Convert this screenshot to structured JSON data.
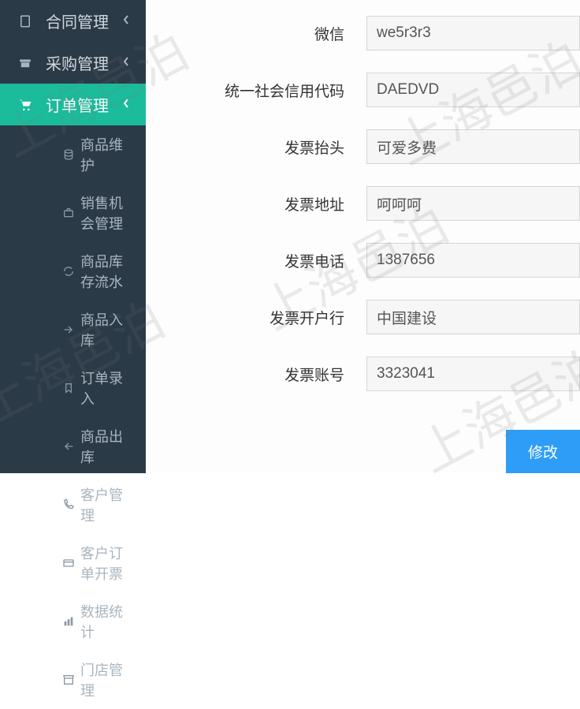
{
  "watermark": "上海邑泊",
  "sidebar": {
    "top_items": [
      {
        "label": "合同管理"
      },
      {
        "label": "采购管理"
      },
      {
        "label": "订单管理"
      }
    ],
    "sub_items": [
      {
        "label": "商品维护"
      },
      {
        "label": "销售机会管理"
      },
      {
        "label": "商品库存流水"
      },
      {
        "label": "商品入库"
      },
      {
        "label": "订单录入"
      },
      {
        "label": "商品出库"
      },
      {
        "label": "客户管理"
      },
      {
        "label": "客户订单开票"
      },
      {
        "label": "数据统计"
      },
      {
        "label": "门店管理"
      }
    ]
  },
  "form": {
    "fields": [
      {
        "label": "微信",
        "value": "we5r3r3"
      },
      {
        "label": "统一社会信用代码",
        "value": "DAEDVD"
      },
      {
        "label": "发票抬头",
        "value": "可爱多费"
      },
      {
        "label": "发票地址",
        "value": "呵呵呵"
      },
      {
        "label": "发票电话",
        "value": "1387656"
      },
      {
        "label": "发票开户行",
        "value": "中国建设"
      },
      {
        "label": "发票账号",
        "value": "3323041"
      }
    ]
  },
  "actions": {
    "submit": "修改"
  }
}
